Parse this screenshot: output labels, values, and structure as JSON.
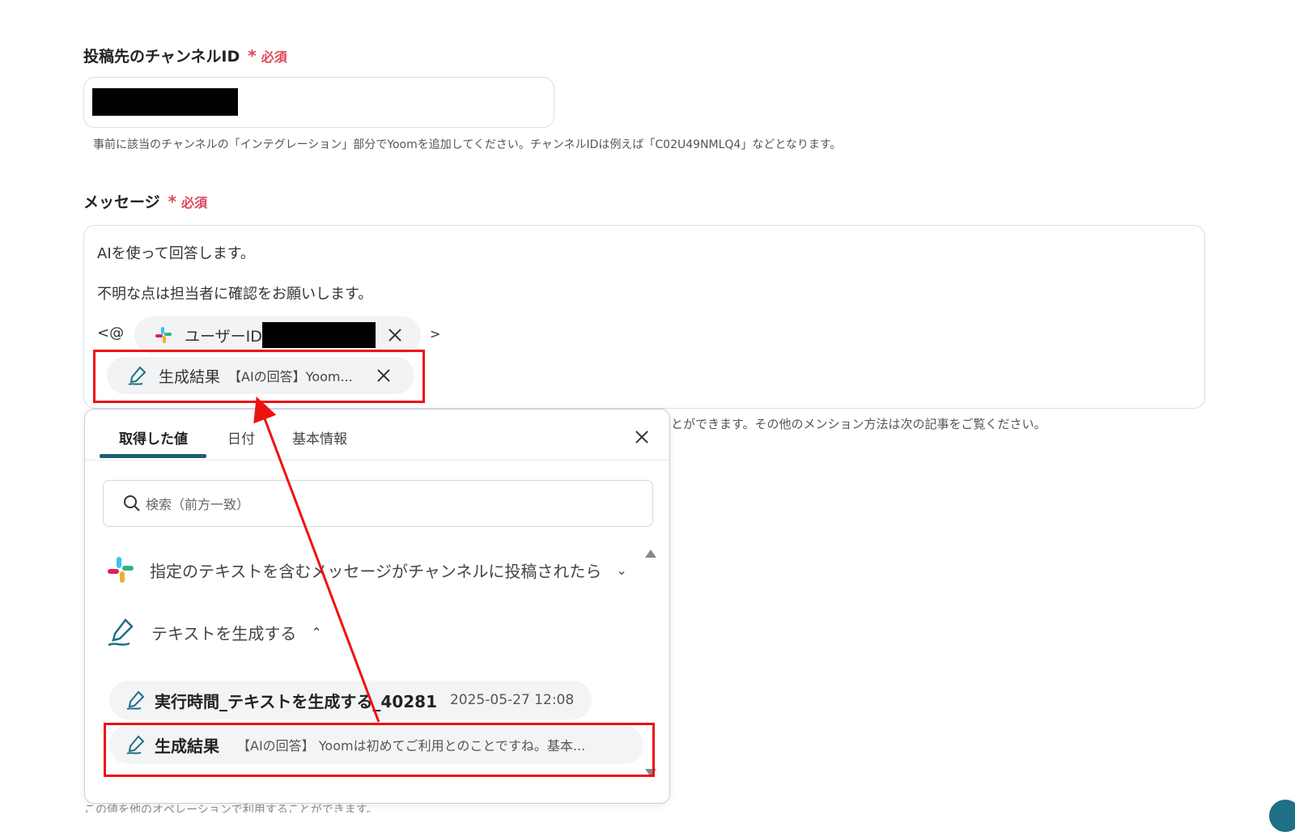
{
  "channel_field": {
    "label": "投稿先のチャンネルID",
    "required_star": "*",
    "required_label": "必須",
    "help": "事前に該当のチャンネルの「インテグレーション」部分でYoomを追加してください。チャンネルIDは例えば「C02U49NMLQ4」などとなります。"
  },
  "message_field": {
    "label": "メッセージ",
    "required_star": "*",
    "required_label": "必須",
    "line1": "AIを使って回答します。",
    "line2": "不明な点は担当者に確認をお願いします。",
    "mention_prefix": "<@",
    "mention_suffix": ">",
    "user_chip_label": "ユーザーID",
    "result_chip_label": "生成結果",
    "result_chip_preview": "【AIの回答】Yoom...",
    "help_tail": "とができます。その他のメンション方法は次の記事をご覧ください。"
  },
  "popup": {
    "tabs": [
      "取得した値",
      "日付",
      "基本情報"
    ],
    "active_tab": 0,
    "search_placeholder": "検索（前方一致）",
    "sections": [
      {
        "label": "指定のテキストを含むメッセージがチャンネルに投稿されたら",
        "icon": "slack-icon",
        "expanded": false
      },
      {
        "label": "テキストを生成する",
        "icon": "pen-icon",
        "expanded": true
      }
    ],
    "items": [
      {
        "title": "実行時間_テキストを生成する_40281",
        "meta": "2025-05-27 12:08"
      },
      {
        "title": "生成結果",
        "meta": "【AIの回答】 Yoomは初めてご利用とのことですね。基本..."
      }
    ]
  },
  "bottom_help": "この値を他のオペレーションで利用することができます。",
  "colors": {
    "required": "#e0465b",
    "highlight": "#ee1111",
    "tab_underline": "#1f5f73"
  }
}
